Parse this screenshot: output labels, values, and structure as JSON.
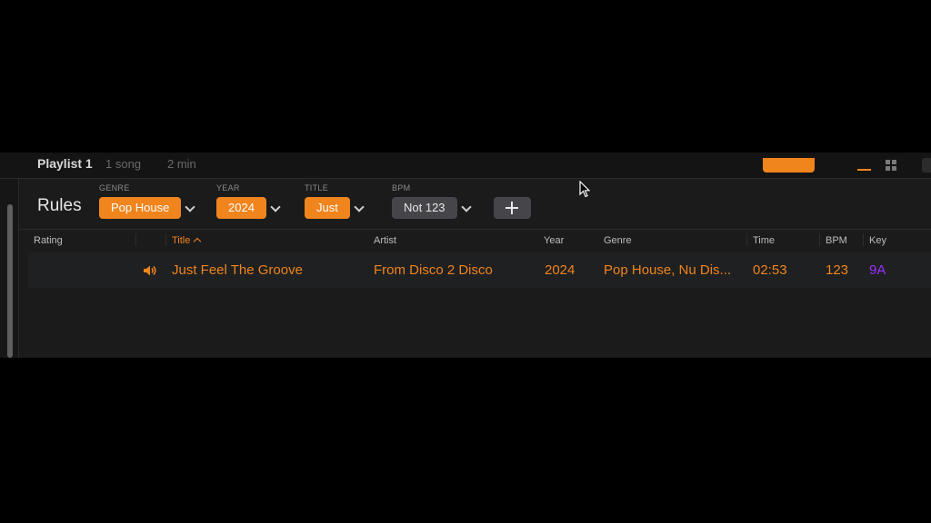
{
  "topbar": {
    "playlist_title": "Playlist 1",
    "song_count": "1 song",
    "duration": "2 min"
  },
  "rules": {
    "title": "Rules",
    "items": [
      {
        "label": "GENRE",
        "value": "Pop House",
        "style": "orange"
      },
      {
        "label": "YEAR",
        "value": "2024",
        "style": "orange"
      },
      {
        "label": "TITLE",
        "value": "Just",
        "style": "orange"
      },
      {
        "label": "BPM",
        "value": "Not 123",
        "style": "gray"
      }
    ],
    "add_icon": "plus-icon"
  },
  "table": {
    "columns": [
      "Rating",
      "Title",
      "Artist",
      "Year",
      "Genre",
      "Time",
      "BPM",
      "Key"
    ],
    "sorted_column": "Title",
    "sort_direction": "ascending",
    "rows": [
      {
        "playing": true,
        "title": "Just Feel The Groove",
        "artist": "From Disco 2 Disco",
        "year": "2024",
        "genre": "Pop House, Nu Dis...",
        "time": "02:53",
        "bpm": "123",
        "key": "9A"
      }
    ]
  },
  "colors": {
    "accent": "#f0841d",
    "key_purple": "#9b30ff",
    "background": "#1b1b1c"
  }
}
